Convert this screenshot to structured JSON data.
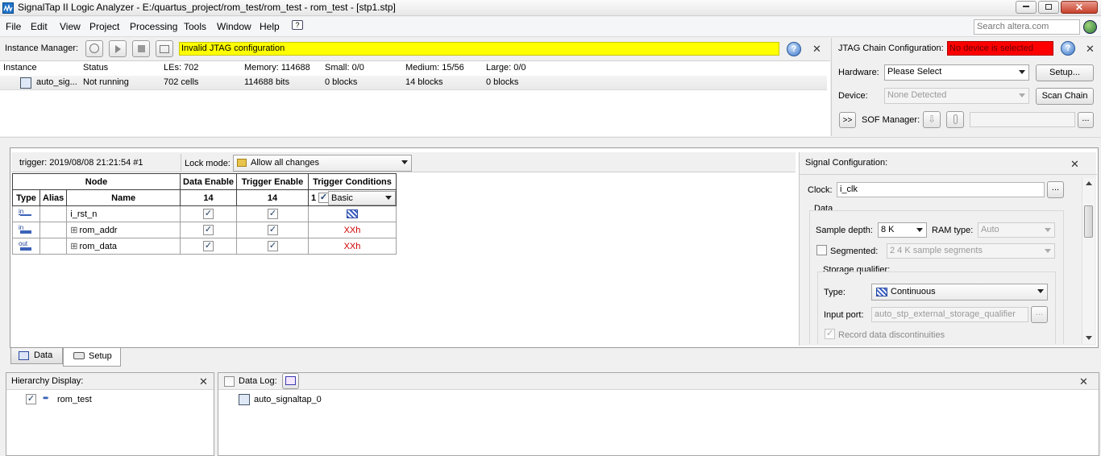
{
  "window": {
    "title": "SignalTap II Logic Analyzer - E:/quartus_project/rom_test/rom_test - rom_test - [stp1.stp]",
    "controls": [
      "minimize",
      "maximize",
      "close"
    ]
  },
  "menu": [
    "File",
    "Edit",
    "View",
    "Project",
    "Processing",
    "Tools",
    "Window",
    "Help"
  ],
  "search": {
    "placeholder": "Search altera.com"
  },
  "instance_manager": {
    "label": "Instance Manager:",
    "status_message": "Invalid JTAG configuration",
    "columns": [
      "Instance",
      "Status",
      "LEs: 702",
      "Memory: 114688",
      "Small: 0/0",
      "Medium: 15/56",
      "Large: 0/0"
    ],
    "row": [
      "auto_sig...",
      "Not running",
      "702 cells",
      "114688 bits",
      "0 blocks",
      "14 blocks",
      "0 blocks"
    ]
  },
  "jtag": {
    "label": "JTAG Chain Configuration:",
    "status": "No device is selected",
    "hardware_label": "Hardware:",
    "hardware_value": "Please Select",
    "setup_button": "Setup...",
    "device_label": "Device:",
    "device_value": "None Detected",
    "scan_button": "Scan Chain",
    "expand_button": ">>",
    "sof_label": "SOF Manager:",
    "browse_button": "..."
  },
  "setup": {
    "trigger_label": "trigger: 2019/08/08 21:21:54  #1",
    "lock_label": "Lock mode:",
    "lock_value": "Allow all changes",
    "table": {
      "group_headers": [
        "Node",
        "Data Enable",
        "Trigger Enable",
        "Trigger Conditions"
      ],
      "sub_headers": [
        "Type",
        "Alias",
        "Name",
        "14",
        "14",
        "1"
      ],
      "trigger_type": "Basic",
      "rows": [
        {
          "type": "in",
          "name": "i_rst_n",
          "expand": "",
          "condition": ""
        },
        {
          "type": "in",
          "name": "rom_addr",
          "expand": "⊞",
          "condition": "XXh"
        },
        {
          "type": "out",
          "name": "rom_data",
          "expand": "⊞",
          "condition": "XXh"
        }
      ]
    }
  },
  "signal_config": {
    "title": "Signal Configuration:",
    "clock_label": "Clock:",
    "clock_value": "i_clk",
    "clock_browse": "...",
    "data_group": "Data",
    "sample_depth_label": "Sample depth:",
    "sample_depth_value": "8 K",
    "ram_type_label": "RAM type:",
    "ram_type_value": "Auto",
    "segmented_label": "Segmented:",
    "segmented_value": "2  4 K sample segments",
    "storage_group": "Storage qualifier:",
    "type_label": "Type:",
    "type_value": "Continuous",
    "input_port_label": "Input port:",
    "input_port_value": "auto_stp_external_storage_qualifier",
    "input_browse": "...",
    "record_label": "Record data discontinuities"
  },
  "tabs": [
    "Data",
    "Setup"
  ],
  "hierarchy": {
    "title": "Hierarchy Display:",
    "item": "rom_test"
  },
  "datalog": {
    "title": "Data Log:",
    "item": "auto_signaltap_0"
  },
  "colors": {
    "status_yellow": "#ffff00",
    "status_red": "#ff0000",
    "condition_red": "#d00000"
  }
}
